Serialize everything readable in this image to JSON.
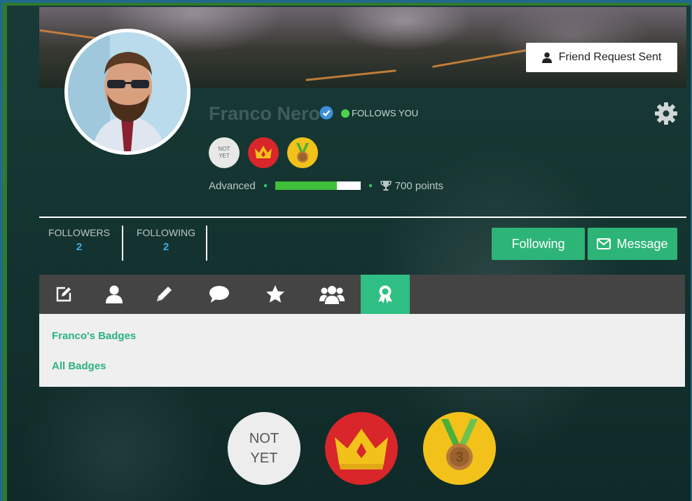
{
  "profile": {
    "name": "Franco Nero",
    "follows_label": "FOLLOWS YOU",
    "friend_request_label": "Friend Request Sent"
  },
  "level": {
    "label": "Advanced",
    "progress_percent": 72,
    "points_label": "700 points"
  },
  "stats": [
    {
      "label": "FOLLOWERS",
      "value": "2"
    },
    {
      "label": "FOLLOWING",
      "value": "2"
    }
  ],
  "actions": {
    "following_label": "Following",
    "message_label": "Message"
  },
  "tabs": [
    {
      "icon": "edit-icon"
    },
    {
      "icon": "user-icon"
    },
    {
      "icon": "pencil-icon"
    },
    {
      "icon": "comment-icon"
    },
    {
      "icon": "star-icon"
    },
    {
      "icon": "group-icon"
    },
    {
      "icon": "badge-icon",
      "active": true
    }
  ],
  "badges_panel": {
    "user_badges_link": "Franco's Badges",
    "all_badges_link": "All Badges"
  },
  "badges": {
    "not_yet_line1": "NOT",
    "not_yet_line2": "YET",
    "medal_number": "3"
  },
  "colors": {
    "accent_green": "#2db577",
    "verified_blue": "#3d8fdc",
    "online_green": "#4cd24c",
    "badge_red": "#d8262a",
    "badge_gold": "#f2c21a",
    "tabbar": "#444444"
  }
}
